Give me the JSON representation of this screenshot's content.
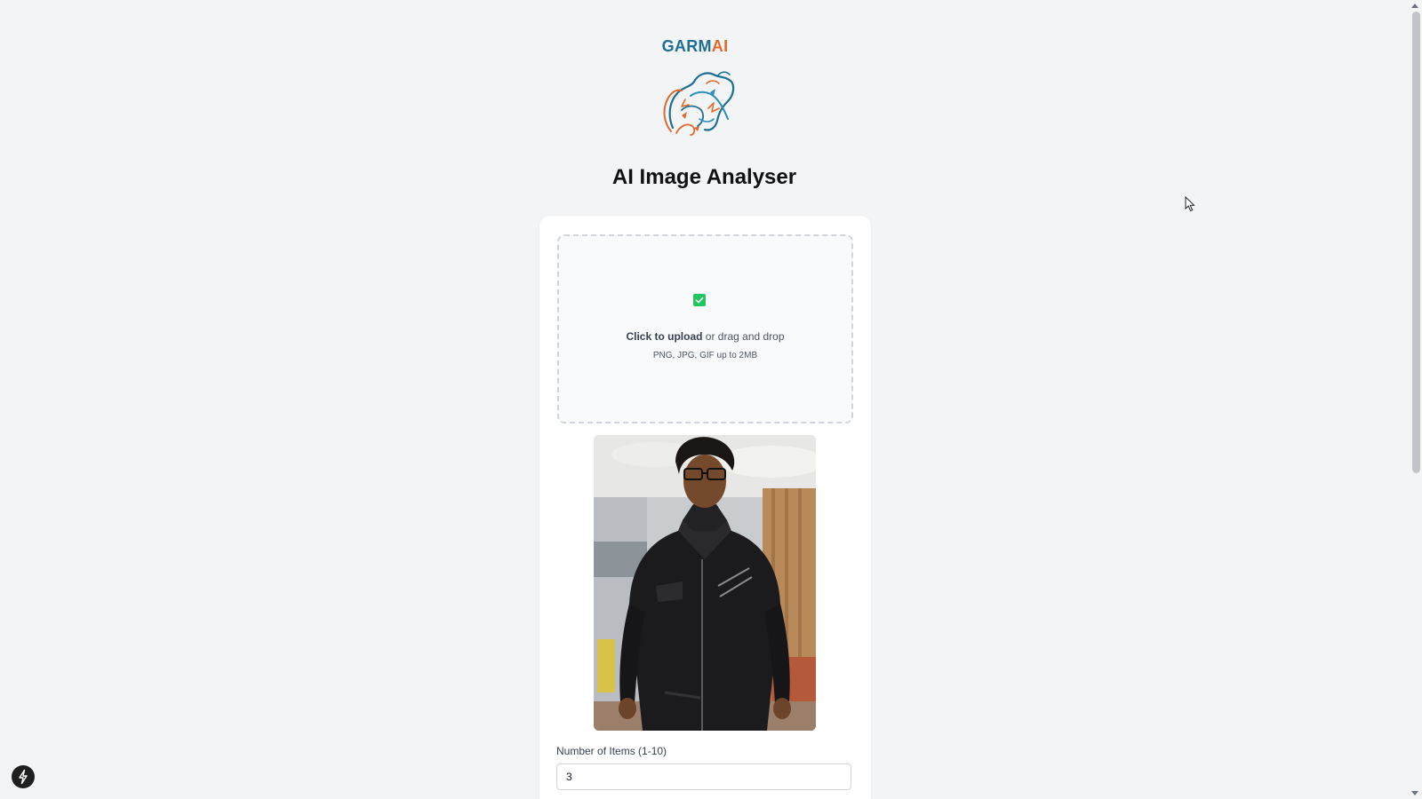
{
  "brand": {
    "logo_text_part1": "GARM",
    "logo_text_part2": "AI",
    "colors": {
      "blue": "#1f6f93",
      "orange": "#e3692b"
    },
    "logo_icon": "bear-illustration-icon"
  },
  "page": {
    "title": "AI Image Analyser"
  },
  "upload": {
    "status_icon": "check-icon",
    "status_color": "#22c55e",
    "click_text": "Click to upload",
    "drag_text": " or drag and drop",
    "hint": "PNG, JPG, GIF up to 2MB"
  },
  "preview": {
    "icon": "uploaded-photo-preview"
  },
  "items_field": {
    "label": "Number of Items (1-10)",
    "value": "3"
  },
  "floating_button": {
    "icon": "lightning-icon"
  }
}
